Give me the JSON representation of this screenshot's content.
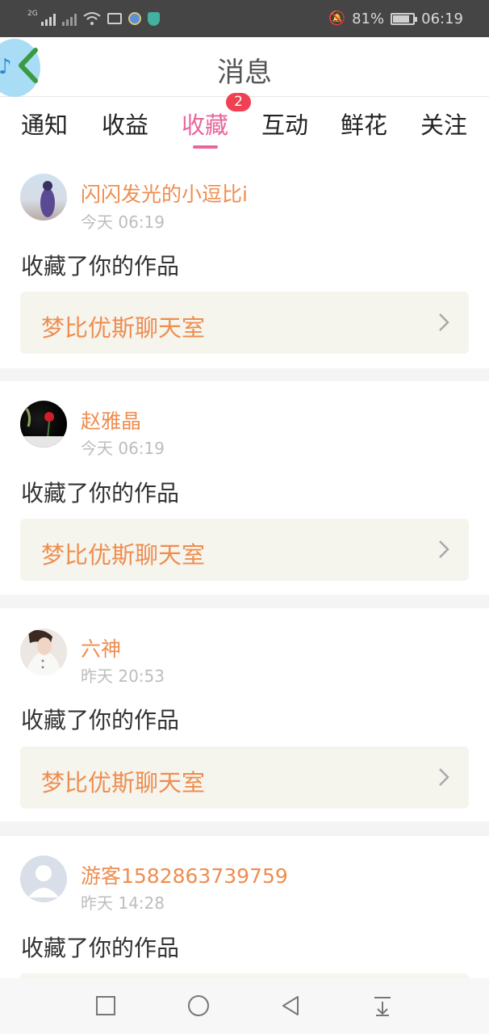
{
  "status_bar": {
    "network": "2G",
    "battery": "81%",
    "battery_level": 0.81,
    "time": "06:19"
  },
  "header": {
    "title": "消息",
    "floating_icon": "music-note-icon",
    "back_icon": "chevron-left-icon"
  },
  "tabs": [
    {
      "label": "通知"
    },
    {
      "label": "收益"
    },
    {
      "label": "收藏",
      "badge": "2"
    },
    {
      "label": "互动"
    },
    {
      "label": "鲜花"
    },
    {
      "label": "关注"
    }
  ],
  "colors": {
    "accent": "#e8669d",
    "name": "#ef8d4f",
    "badge": "#f04052",
    "work_bg": "#f5f5ee"
  },
  "messages": [
    {
      "name": "闪闪发光的小逗比i",
      "time": "今天 06:19",
      "action": "收藏了你的作品",
      "work_title": "梦比优斯聊天室"
    },
    {
      "name": "赵雅晶",
      "time": "今天 06:19",
      "action": "收藏了你的作品",
      "work_title": "梦比优斯聊天室"
    },
    {
      "name": "六神",
      "time": "昨天 20:53",
      "action": "收藏了你的作品",
      "work_title": "梦比优斯聊天室"
    },
    {
      "name": "游客1582863739759",
      "time": "昨天 14:28",
      "action": "收藏了你的作品"
    }
  ],
  "nav_bar": {
    "icons": [
      "square-icon",
      "circle-icon",
      "triangle-back-icon",
      "download-icon"
    ]
  }
}
